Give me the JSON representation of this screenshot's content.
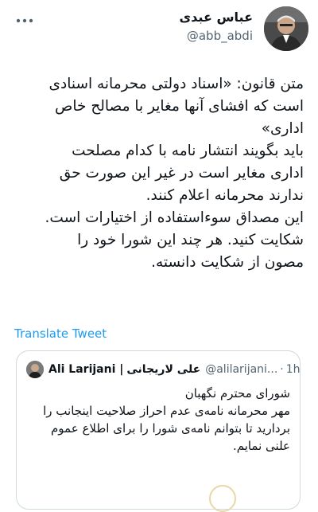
{
  "author": {
    "name": "عباس عبدی",
    "handle": "@abb_abdi"
  },
  "tweet_lines": [
    "متن قانون: «اسناد دولتی محرمانه اسنادی",
    "است که افشای آنها مغایر با مصالح خاص",
    "اداری»",
    "باید بگویند انتشار نامه با کدام مصلحت",
    "اداری مغایر است در غیر این صورت حق",
    "ندارند محرمانه اعلام کنند.",
    "این مصداق سوءاستفاده از اختیارات است.",
    "شکایت کنید. هر چند این شورا خود را",
    "مصون از شکایت دانسته."
  ],
  "translate_label": "Translate Tweet",
  "quoted": {
    "name_en": "Ali Larijani |",
    "name_fa": "علی لاریجانی",
    "handle": "@alilarijani...",
    "separator": "·",
    "time": "1h",
    "lines": [
      "شورای محترم نگهبان",
      "مهر محرمانه نامه‌ی عدم احراز صلاحیت اینجانب را",
      "بردارید تا بتوانم نامه‌ی شورا را برای اطلاع عموم",
      "علنی نمایم."
    ]
  },
  "icons": {
    "more": "more-horizontal-icon"
  }
}
